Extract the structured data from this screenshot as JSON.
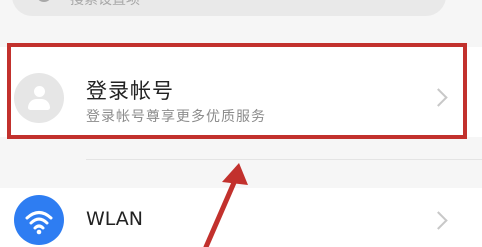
{
  "search": {
    "placeholder": "搜索设置项",
    "icon": "search-icon",
    "mic_icon": "mic-icon"
  },
  "account": {
    "title": "登录帐号",
    "subtitle": "登录帐号尊享更多优质服务",
    "avatar_icon": "avatar-icon",
    "chevron_icon": "chevron-right-icon"
  },
  "wlan": {
    "label": "WLAN",
    "icon": "wifi-icon",
    "icon_color": "#2e7df2",
    "chevron_icon": "chevron-right-icon"
  },
  "annotation": {
    "highlight_color": "#c2312d",
    "arrow_color": "#c2312d"
  }
}
